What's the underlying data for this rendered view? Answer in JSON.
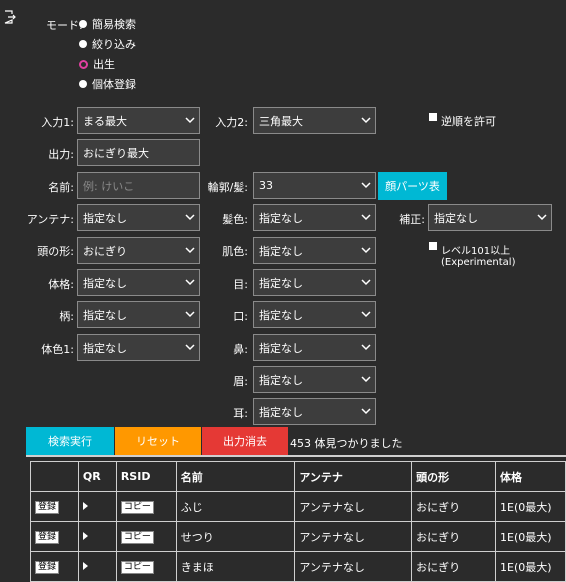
{
  "mode": {
    "label": "モード:",
    "options": [
      "簡易検索",
      "絞り込み",
      "出生",
      "個体登録"
    ],
    "selected_index": 2
  },
  "form": {
    "input1": {
      "label": "入力1:",
      "value": "まる最大"
    },
    "input2": {
      "label": "入力2:",
      "value": "三角最大"
    },
    "reverse": {
      "label": "逆順を許可",
      "checked": false
    },
    "output": {
      "label": "出力:",
      "value": "おにぎり最大"
    },
    "name": {
      "label": "名前:",
      "placeholder": "例: けいこ"
    },
    "outline": {
      "label": "輪郭/髪:",
      "value": "33"
    },
    "face_parts_button": "顔パーツ表",
    "antenna": {
      "label": "アンテナ:",
      "value": "指定なし"
    },
    "hair_color": {
      "label": "髪色:",
      "value": "指定なし"
    },
    "correction": {
      "label": "補正:",
      "value": "指定なし"
    },
    "head_shape": {
      "label": "頭の形:",
      "value": "おにぎり"
    },
    "skin_color": {
      "label": "肌色:",
      "value": "指定なし"
    },
    "level101": {
      "label": "レベル101以上(Experimental)",
      "checked": false
    },
    "body": {
      "label": "体格:",
      "value": "指定なし"
    },
    "eyes": {
      "label": "目:",
      "value": "指定なし"
    },
    "pattern": {
      "label": "柄:",
      "value": "指定なし"
    },
    "mouth": {
      "label": "口:",
      "value": "指定なし"
    },
    "body_color1": {
      "label": "体色1:",
      "value": "指定なし"
    },
    "nose": {
      "label": "鼻:",
      "value": "指定なし"
    },
    "eyebrows": {
      "label": "眉:",
      "value": "指定なし"
    },
    "ears": {
      "label": "耳:",
      "value": "指定なし"
    }
  },
  "actions": {
    "search": "検索実行",
    "reset": "リセット",
    "clear_output": "出力消去",
    "result_count": "453 体見つかりました"
  },
  "table": {
    "headers": [
      "",
      "QR",
      "RSID",
      "名前",
      "アンテナ",
      "頭の形",
      "体格"
    ],
    "register_label": "登録",
    "copy_label": "コピー",
    "rows": [
      {
        "name": "ふじ",
        "antenna": "アンテナなし",
        "head": "おにぎり",
        "body": "1E(0最大)"
      },
      {
        "name": "せつり",
        "antenna": "アンテナなし",
        "head": "おにぎり",
        "body": "1E(0最大)"
      },
      {
        "name": "きまほ",
        "antenna": "アンテナなし",
        "head": "おにぎり",
        "body": "1E(0最大)"
      }
    ]
  },
  "colors": {
    "background": "#2b2b2b",
    "search_button": "#00b8d4",
    "reset_button": "#ff9800",
    "clear_button": "#e53935",
    "face_parts_button": "#00b8d4",
    "radio_checked_ring": "#e040a0"
  }
}
